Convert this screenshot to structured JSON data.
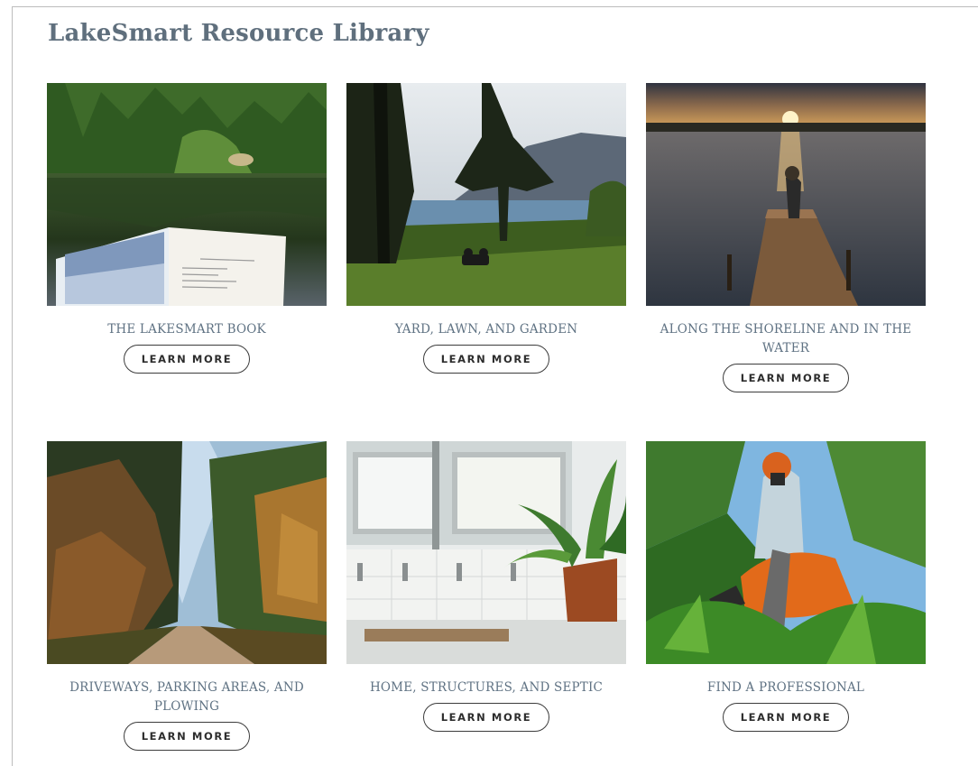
{
  "page": {
    "title": "LakeSmart Resource Library"
  },
  "cards": [
    {
      "title": "THE LAKESMART BOOK",
      "button": "LEARN MORE",
      "image": "book-on-lake-photo"
    },
    {
      "title": "YARD, LAWN, AND GARDEN",
      "button": "LEARN MORE",
      "image": "sunset-lawn-photo"
    },
    {
      "title": "ALONG THE SHORELINE AND IN THE WATER",
      "button": "LEARN MORE",
      "image": "dock-sunset-photo"
    },
    {
      "title": "DRIVEWAYS, PARKING AREAS, AND PLOWING",
      "button": "LEARN MORE",
      "image": "forest-road-photo"
    },
    {
      "title": "HOME, STRUCTURES, AND SEPTIC",
      "button": "LEARN MORE",
      "image": "sink-plant-photo"
    },
    {
      "title": "FIND A PROFESSIONAL",
      "button": "LEARN MORE",
      "image": "brush-cutter-photo"
    }
  ]
}
